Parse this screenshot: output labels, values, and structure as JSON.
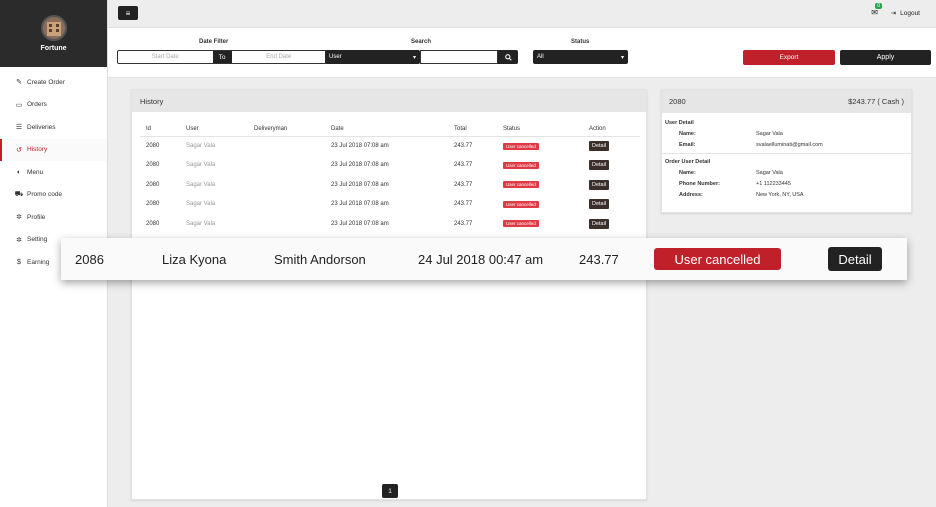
{
  "brand": {
    "name": "Fortune"
  },
  "sidebar": {
    "items": [
      {
        "label": "Create Order",
        "icon": "edit-icon",
        "glyph": "✎"
      },
      {
        "label": "Orders",
        "icon": "inbox-icon",
        "glyph": "▭"
      },
      {
        "label": "Deliveries",
        "icon": "list-icon",
        "glyph": "☰"
      },
      {
        "label": "History",
        "icon": "history-icon",
        "glyph": "↺",
        "active": true
      },
      {
        "label": "Menu",
        "icon": "food-icon",
        "glyph": "◐"
      },
      {
        "label": "Promo code",
        "icon": "cart-icon",
        "glyph": "⛟"
      },
      {
        "label": "Profile",
        "icon": "gear-icon",
        "glyph": "✲"
      },
      {
        "label": "Setting",
        "icon": "cog-icon",
        "glyph": "✲"
      },
      {
        "label": "Earning",
        "icon": "dollar-icon",
        "glyph": "$"
      }
    ]
  },
  "topbar": {
    "mail_badge": "0",
    "logout_label": "Logout"
  },
  "filters": {
    "date_filter_label": "Date Filter",
    "start_placeholder": "Start Date",
    "to_label": "To",
    "end_placeholder": "End Date",
    "search_label": "Search",
    "search_field_value": "User",
    "status_label": "Status",
    "status_value": "All",
    "export_label": "Export",
    "apply_label": "Apply"
  },
  "history": {
    "title": "History",
    "columns": [
      "Id",
      "User",
      "Deliveryman",
      "Date",
      "Total",
      "Status",
      "Action"
    ],
    "rows": [
      {
        "id": "2080",
        "user": "Sagar Vala",
        "deliveryman": "",
        "date": "23 Jul 2018 07:08 am",
        "total": "243.77",
        "status": "User cancelled",
        "action": "Detail"
      },
      {
        "id": "2080",
        "user": "Sagar Vala",
        "deliveryman": "",
        "date": "23 Jul 2018 07:08 am",
        "total": "243.77",
        "status": "User cancelled",
        "action": "Detail"
      },
      {
        "id": "2080",
        "user": "Sagar Vala",
        "deliveryman": "",
        "date": "23 Jul 2018 07:08 am",
        "total": "243.77",
        "status": "User cancelled",
        "action": "Detail"
      },
      {
        "id": "2080",
        "user": "Sagar Vala",
        "deliveryman": "",
        "date": "23 Jul 2018 07:08 am",
        "total": "243.77",
        "status": "User cancelled",
        "action": "Detail"
      },
      {
        "id": "2080",
        "user": "Sagar Vala",
        "deliveryman": "",
        "date": "23 Jul 2018 07:08 am",
        "total": "243.77",
        "status": "User cancelled",
        "action": "Detail"
      }
    ],
    "page": "1"
  },
  "detail": {
    "order_id": "2080",
    "amount": "$243.77 ( Cash )",
    "user_section": "User Detail",
    "name_label": "Name:",
    "name_value": "Sagar Vala",
    "email_label": "Email:",
    "email_value": "svalaelluminati@gmail.com",
    "order_user_section": "Order User Detail",
    "ou_name_label": "Name:",
    "ou_name_value": "Sagar Vala",
    "phone_label": "Phone Number:",
    "phone_value": "+1 112233445",
    "address_label": "Address:",
    "address_value": "New York, NY, USA"
  },
  "highlight_row": {
    "id": "2086",
    "user": "Liza Kyona",
    "deliveryman": "Smith Andorson",
    "date": "24 Jul 2018 00:47 am",
    "total": "243.77",
    "status": "User cancelled",
    "action": "Detail"
  },
  "colors": {
    "accent_red": "#c0202a",
    "dark": "#222222",
    "sidebar_brand_bg": "#2b2b2b"
  }
}
